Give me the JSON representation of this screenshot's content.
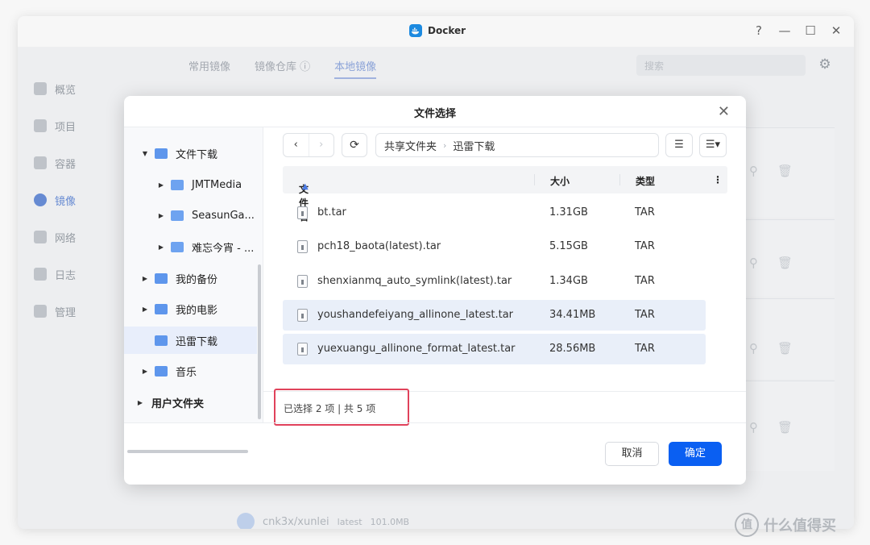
{
  "window": {
    "title": "Docker",
    "controls": [
      "?",
      "—",
      "☐",
      "✕"
    ]
  },
  "sidebar": {
    "items": [
      {
        "label": "概览",
        "active": false
      },
      {
        "label": "项目",
        "active": false
      },
      {
        "label": "容器",
        "active": false
      },
      {
        "label": "镜像",
        "active": true
      },
      {
        "label": "网络",
        "active": false
      },
      {
        "label": "日志",
        "active": false
      },
      {
        "label": "管理",
        "active": false
      }
    ]
  },
  "main": {
    "tabs": [
      {
        "label": "常用镜像",
        "active": false
      },
      {
        "label": "镜像仓库 ⓘ",
        "active": false
      },
      {
        "label": "本地镜像",
        "active": true
      }
    ],
    "search_placeholder": "搜索",
    "bottom_item": {
      "name": "cnk3x/xunlei",
      "tag": "latest",
      "size": "101.0MB"
    }
  },
  "dialog": {
    "title": "文件选择",
    "close": "✕",
    "tree": [
      {
        "label": "文件下载",
        "arrow": "▼",
        "selected": false
      },
      {
        "label": "JMTMedia",
        "arrow": "▶",
        "selected": false
      },
      {
        "label": "SeasunGa...",
        "arrow": "▶",
        "selected": false
      },
      {
        "label": "难忘今宵 - ...",
        "arrow": "▶",
        "selected": false
      },
      {
        "label": "我的备份",
        "arrow": "▶",
        "selected": false
      },
      {
        "label": "我的电影",
        "arrow": "▶",
        "selected": false
      },
      {
        "label": "迅雷下载",
        "arrow": "",
        "selected": true
      },
      {
        "label": "音乐",
        "arrow": "▶",
        "selected": false
      },
      {
        "label": "用户文件夹",
        "arrow": "▶",
        "selected": false
      }
    ],
    "toolbar": {
      "back": "‹",
      "forward": "›",
      "refresh": "⟳",
      "path": [
        "共享文件夹",
        "迅雷下载"
      ],
      "path_sep": "›",
      "list_view_icon": "☰",
      "sort_icon": "☰▾"
    },
    "columns": {
      "name": "文件名",
      "size": "大小",
      "type": "类型",
      "more": "⋮",
      "sort_icon": "▲"
    },
    "files": [
      {
        "name": "bt.tar",
        "size": "1.31GB",
        "type": "TAR",
        "selected": false
      },
      {
        "name": "pch18_baota(latest).tar",
        "size": "5.15GB",
        "type": "TAR",
        "selected": false
      },
      {
        "name": "shenxianmq_auto_symlink(latest).tar",
        "size": "1.34GB",
        "type": "TAR",
        "selected": false
      },
      {
        "name": "youshandefeiyang_allinone_latest.tar",
        "size": "34.41MB",
        "type": "TAR",
        "selected": true
      },
      {
        "name": "yuexuangu_allinone_format_latest.tar",
        "size": "28.56MB",
        "type": "TAR",
        "selected": true
      }
    ],
    "status": "已选择 2 项 | 共 5 项",
    "buttons": {
      "cancel": "取消",
      "confirm": "确定"
    }
  },
  "watermark": {
    "text": "什么值得买",
    "logo": "值"
  }
}
